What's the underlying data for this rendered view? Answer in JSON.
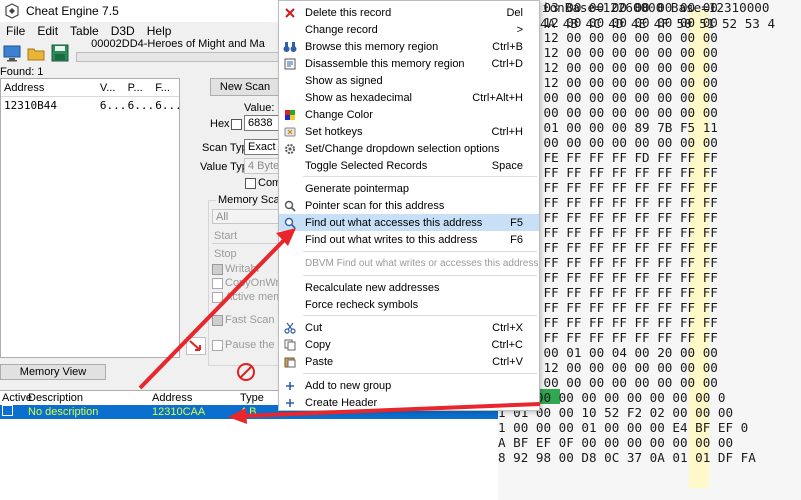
{
  "window": {
    "title": "Cheat Engine 7.5"
  },
  "menubar": [
    "File",
    "Edit",
    "Table",
    "D3D",
    "Help"
  ],
  "process": {
    "name": "00002DD4-Heroes of Might and Ma"
  },
  "found": "Found: 1",
  "results": {
    "headers": [
      "Address",
      "V...",
      "P...",
      "F..."
    ],
    "rows": [
      [
        "12310B44",
        "6...",
        "6...",
        "6..."
      ]
    ]
  },
  "scan": {
    "new_scan": "New Scan",
    "value_label": "Value:",
    "hex_label": "Hex",
    "value": "6838",
    "scan_type_label": "Scan Type",
    "scan_type_value": "Exact Va",
    "value_type_label": "Value Type",
    "value_type_value": "4 Bytes",
    "compare_label": "Com",
    "memory_group_label": "Memory Scan O",
    "region_value": "All",
    "start_label": "Start",
    "stop_label": "Stop",
    "writable_label": "Writabl",
    "copyonwrite_label": "CopyOnWrite",
    "active_memory_label": "Active memo",
    "fast_scan_label": "Fast Scan",
    "pause_label": "Pause the gar",
    "memory_view": "Memory View"
  },
  "address_list": {
    "headers": [
      "Active",
      "Description",
      "Address",
      "Type"
    ],
    "rows": [
      {
        "description": "No description",
        "address": "12310CAA",
        "type": "4 B"
      }
    ]
  },
  "hexview": {
    "header": "ionBase=12260000 Base=12310000",
    "columns": "4A 4B 4C 4D 4E 4F 50 51 52 53 4",
    "rows": [
      "00 00 03 00 00 00 00 00 00 00",
      "FF FF 12 00 00 00 00 00 00 00",
      "00 00 12 00 00 00 00 00 00 00",
      "00 00 12 00 00 00 00 00 00 00",
      "00 00 12 00 00 00 00 00 00 00",
      "00 00 12 00 00 00 00 00 00 00",
      "00 00 00 00 00 00 00 00 00 00",
      "00 00 00 00 00 00 00 00 00 00",
      "00 00 01 00 00 00 89 7B F5 11",
      "00 00 00 00 00 00 00 00 00 00",
      "00 00 FE FF FF FF FD FF FF FF",
      "FF FF FF FF FF FF FF FF FF FF",
      "FF FF FF FF FF FF FF FF FF FF",
      "FF FF FF FF FF FF FF FF FF FF",
      "FF FF FF FF FF FF FF FF FF FF",
      "FF FF FF FF FF FF FF FF FF FF",
      "FF FF FF FF FF FF FF FF FF FF",
      "FF FF FF FF FF FF FF FF FF FF",
      "FF FF FF FF FF FF FF FF FF FF",
      "FF FF FF FF FF FF FF FF FF FF",
      "FF FF FF FF FF FF FF FF FF FF",
      "FF FF FF FF FF FF FF FF FF FF",
      "FF FF FF FF FF FF FF FF FF FF",
      "00 00 00 01 00 04 00 20 00 00",
      "00 00 12 00 00 00 00 00 00 00",
      "00 00 00 00 00 00 00 00 00 00",
      "0 00 00 00 00 00 00 00 00 00 0",
      "1 01 00 00 10 52 F2 02 00 00 00",
      "1 00 00 00 01 00 00 00 E4 BF EF 0",
      "A BF EF 0F 00 00 00 00 00 00 00",
      "8 92 98 00 D8 0C 37 0A 01 01 DF FA"
    ]
  },
  "context_menu": {
    "items": [
      {
        "label": "Delete this record",
        "shortcut": "Del",
        "icon": "delete-x-icon"
      },
      {
        "label": "Change record",
        "shortcut": ">",
        "icon": ""
      },
      {
        "label": "Browse this memory region",
        "shortcut": "Ctrl+B",
        "icon": "binoculars-icon"
      },
      {
        "label": "Disassemble this memory region",
        "shortcut": "Ctrl+D",
        "icon": "disassemble-icon"
      },
      {
        "label": "Show as signed",
        "shortcut": "",
        "icon": ""
      },
      {
        "label": "Show as hexadecimal",
        "shortcut": "Ctrl+Alt+H",
        "icon": ""
      },
      {
        "label": "Change Color",
        "shortcut": "",
        "icon": "palette-icon"
      },
      {
        "label": "Set hotkeys",
        "shortcut": "Ctrl+H",
        "icon": "hotkey-icon"
      },
      {
        "label": "Set/Change dropdown selection options",
        "shortcut": "",
        "icon": "gear-icon"
      },
      {
        "label": "Toggle Selected Records",
        "shortcut": "Space",
        "icon": ""
      },
      {
        "label": "Generate pointermap",
        "shortcut": "",
        "icon": ""
      },
      {
        "label": "Pointer scan for this address",
        "shortcut": "",
        "icon": "magnifier-icon"
      },
      {
        "label": "Find out what accesses this address",
        "shortcut": "F5",
        "icon": "find-access-icon"
      },
      {
        "label": "Find out what writes to this address",
        "shortcut": "F6",
        "icon": ""
      },
      {
        "label": "DBVM Find out what writes or accesses this address",
        "shortcut": "",
        "icon": ""
      },
      {
        "label": "Recalculate new addresses",
        "shortcut": "",
        "icon": ""
      },
      {
        "label": "Force recheck symbols",
        "shortcut": "",
        "icon": ""
      },
      {
        "label": "Cut",
        "shortcut": "Ctrl+X",
        "icon": "scissors-icon"
      },
      {
        "label": "Copy",
        "shortcut": "Ctrl+C",
        "icon": "copy-icon"
      },
      {
        "label": "Paste",
        "shortcut": "Ctrl+V",
        "icon": "paste-icon"
      },
      {
        "label": "Add to new group",
        "shortcut": "",
        "icon": "plus-icon"
      },
      {
        "label": "Create Header",
        "shortcut": "",
        "icon": "plus-icon"
      }
    ]
  },
  "colors": {
    "highlight_row": "#0b6fcf",
    "highlight_text": "#d7ff3a",
    "menu_selection": "#c7dff7",
    "annotation_arrow": "#e8262b"
  }
}
